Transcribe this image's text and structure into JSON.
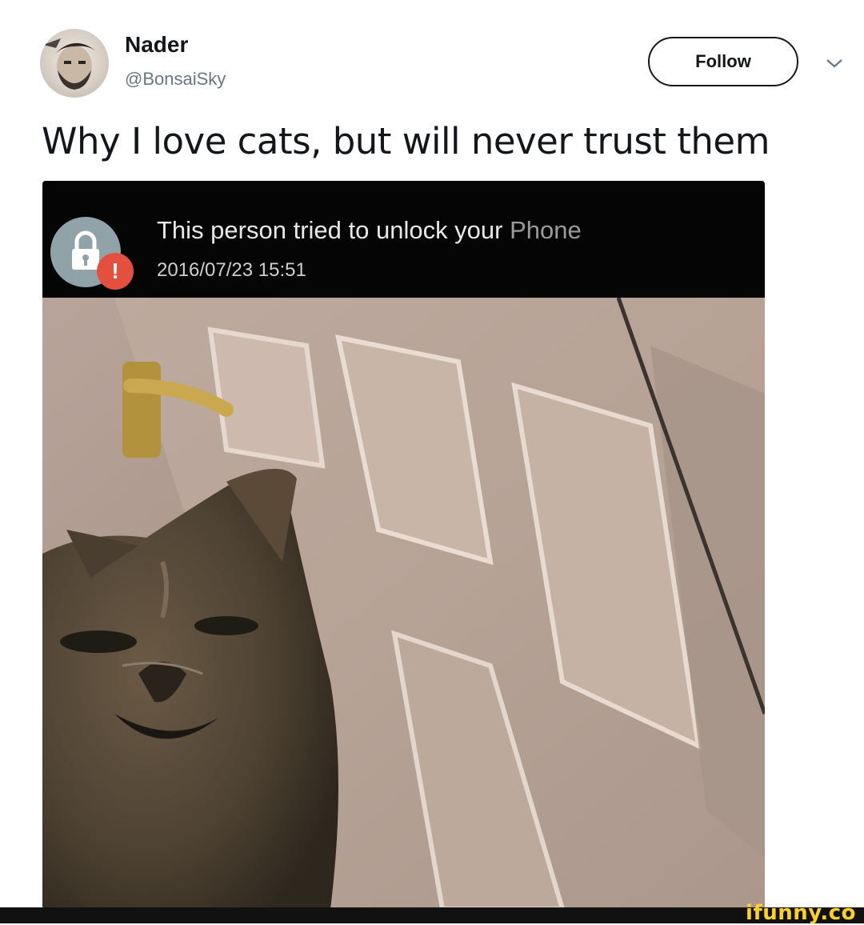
{
  "user": {
    "name": "Nader",
    "handle": "@BonsaiSky"
  },
  "follow_button": {
    "label": "Follow"
  },
  "tweet": {
    "text": "Why I love cats, but will never trust them"
  },
  "notification": {
    "title_main": "This person tried to unlock your",
    "title_dim": " Phone",
    "timestamp": "2016/07/23 15:51",
    "badge": "!",
    "icons": [
      "lock-icon",
      "alert-icon"
    ]
  },
  "watermark": {
    "text": "ifunny.co"
  },
  "colors": {
    "text": "#14171a",
    "muted": "#657786",
    "notif_bg": "#050505",
    "alert": "#e4503f",
    "lock_bg": "#8fa3a8",
    "watermark": "#ffd21f"
  }
}
